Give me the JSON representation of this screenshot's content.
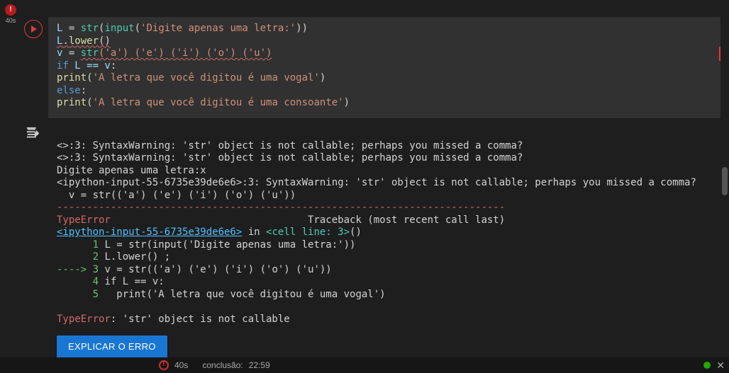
{
  "rail": {
    "badge": "!",
    "time": "40s"
  },
  "toolbar": {
    "up": "arrow-up",
    "down": "arrow-down",
    "link": "link",
    "comment": "comment",
    "settings": "gear",
    "mirror": "mirror",
    "delete": "trash",
    "more": "more-vert"
  },
  "code": {
    "l1": {
      "var": "L",
      "eq": " = ",
      "str": "str",
      "op": "(",
      "input": "input",
      "op2": "(",
      "arg": "'Digite apenas uma letra:'",
      "cl": "))"
    },
    "l2": {
      "var": "L",
      "dot": ".",
      "fn": "lower",
      "par": "()"
    },
    "l3": {
      "var": "v",
      "eq": " = ",
      "str": "str",
      "body": "('a') ('e') ('i') ('o') ('u')"
    },
    "l4": {
      "kw": "if",
      "cond": " L == v",
      "col": ":"
    },
    "l5": {
      "pad": "    ",
      "fn": "print",
      "op": "(",
      "arg": "'A letra que você digitou é uma vogal'",
      "cl": ")"
    },
    "l6": {
      "kw": "else",
      "col": ":"
    },
    "l7": {
      "pad": "    ",
      "fn": "print",
      "op": "(",
      "arg": "'A letra que você digitou é uma consoante'",
      "cl": ")"
    }
  },
  "output": {
    "w1": "<>:3: SyntaxWarning: 'str' object is not callable; perhaps you missed a comma?",
    "w2": "<>:3: SyntaxWarning: 'str' object is not callable; perhaps you missed a comma?",
    "prompt": "Digite apenas uma letra:x",
    "w3": "<ipython-input-55-6735e39de6e6>:3: SyntaxWarning: 'str' object is not callable; perhaps you missed a comma?",
    "w3src": "  v = str(('a') ('e') ('i') ('o') ('u'))",
    "dashes": "---------------------------------------------------------------------------",
    "tb_head_err": "TypeError",
    "tb_head_rest": "                                 Traceback (most recent call last)",
    "link": "<ipython-input-55-6735e39de6e6>",
    "link_rest_a": " in ",
    "link_rest_b": "<cell line: 3>",
    "link_rest_c": "()",
    "t1_n": "      1",
    "t1": " L = str(input('Digite apenas uma letra:'))",
    "t2_n": "      2",
    "t2": " L.lower() ;",
    "t3_arrow": "----> ",
    "t3_n": "3",
    "t3": " v = str(('a') ('e') ('i') ('o') ('u'))",
    "t4_n": "      4",
    "t4": " if L == v:",
    "t5_n": "      5",
    "t5": "   print('A letra que você digitou é uma vogal')",
    "final_err": "TypeError",
    "final_rest": ": 'str' object is not callable",
    "explain_btn": "EXPLICAR O ERRO"
  },
  "status": {
    "time": "40s",
    "completion_label": "conclusão:",
    "completion_time": "22:59"
  }
}
